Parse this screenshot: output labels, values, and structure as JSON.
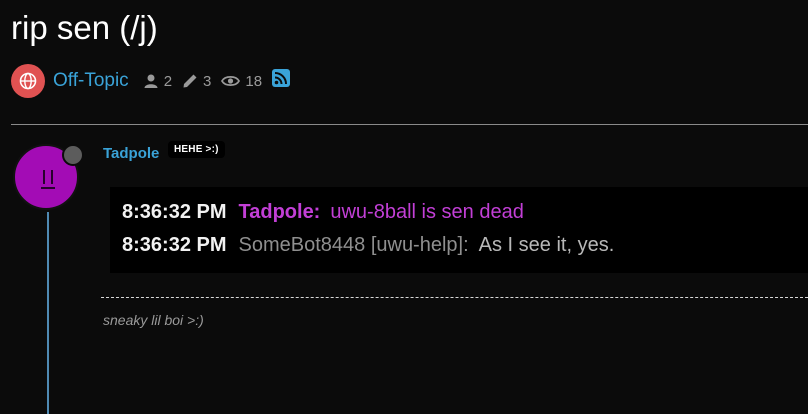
{
  "topic": {
    "title": "rip sen (/j)",
    "category": "Off-Topic",
    "posters": "2",
    "replies": "3",
    "views": "18"
  },
  "post": {
    "username": "Tadpole",
    "user_title": "HEHE >:)",
    "signature": "sneaky lil boi >:)",
    "avatar_color": "#a30cb5",
    "chat_lines": [
      {
        "time": "8:36:32 PM",
        "nick": "Tadpole:",
        "message": "uwu-8ball is sen dead"
      },
      {
        "time": "8:36:32 PM",
        "nick": "SomeBot8448 [uwu-help]:",
        "message": "As I see it, yes."
      }
    ]
  },
  "colors": {
    "accent": "#3aa3d8",
    "category_badge": "#e05252",
    "nick_purple": "#c23fd6"
  }
}
